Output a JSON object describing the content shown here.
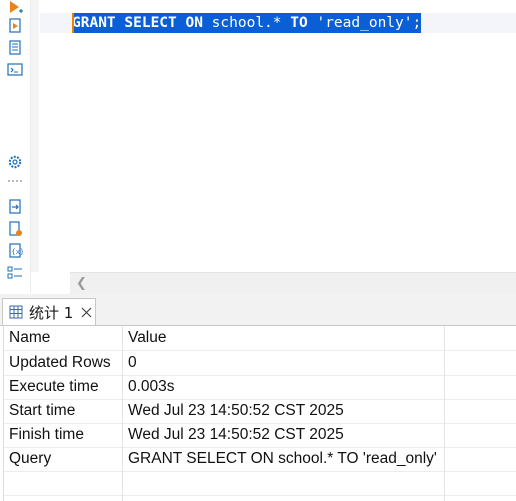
{
  "editor": {
    "sql": {
      "kw1": "GRANT SELECT ON",
      "mid": " school.* ",
      "kw2": "TO",
      "end": " 'read_only';"
    }
  },
  "toolbar": {
    "icons": [
      "execute-icon",
      "execute-script-icon",
      "explain-plan-icon",
      "terminal-icon",
      "settings-icon",
      "more-icon",
      "export-icon",
      "save-icon",
      "variables-icon",
      "outline-icon"
    ]
  },
  "results": {
    "tab_label": "统计 1",
    "columns": [
      "Name",
      "Value"
    ],
    "rows": [
      {
        "name": "Updated Rows",
        "value": "0"
      },
      {
        "name": "Execute time",
        "value": "0.003s"
      },
      {
        "name": "Start time",
        "value": "Wed Jul 23 14:50:52 CST 2025"
      },
      {
        "name": "Finish time",
        "value": "Wed Jul 23 14:50:52 CST 2025"
      },
      {
        "name": "Query",
        "value": "GRANT SELECT ON school.* TO 'read_only'"
      }
    ]
  },
  "colors": {
    "selection": "#0b5fd6",
    "caret": "#f08000",
    "tool_accent": "#e8821c",
    "tool_blue": "#1e6fb8"
  }
}
